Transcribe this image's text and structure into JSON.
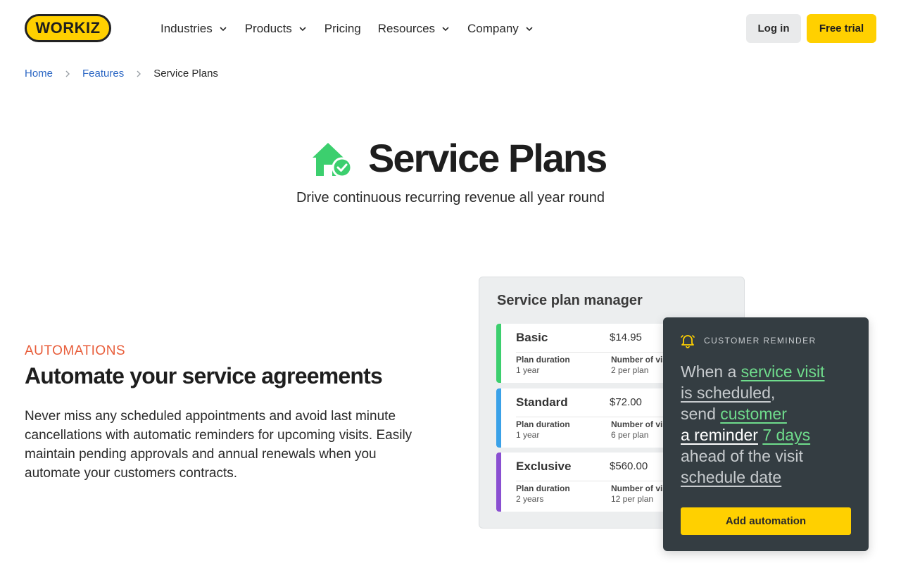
{
  "header": {
    "logo_text": "WORKIZ",
    "nav": [
      {
        "label": "Industries",
        "has_dropdown": true
      },
      {
        "label": "Products",
        "has_dropdown": true
      },
      {
        "label": "Pricing",
        "has_dropdown": false
      },
      {
        "label": "Resources",
        "has_dropdown": true
      },
      {
        "label": "Company",
        "has_dropdown": true
      }
    ],
    "login_label": "Log in",
    "trial_label": "Free trial"
  },
  "breadcrumb": {
    "home": "Home",
    "features": "Features",
    "current": "Service Plans"
  },
  "hero": {
    "icon": "house-check-icon",
    "title": "Service Plans",
    "subtitle": "Drive continuous recurring revenue all year round"
  },
  "section": {
    "eyebrow": "AUTOMATIONS",
    "title": "Automate your service agreements",
    "body": "Never miss any scheduled appointments and avoid last minute cancellations with automatic reminders for upcoming visits. Easily maintain pending approvals and annual renewals when you automate your customers contracts."
  },
  "plan_manager": {
    "title": "Service plan manager",
    "plans": [
      {
        "name": "Basic",
        "price": "$14.95",
        "duration_label": "Plan duration",
        "duration": "1 year",
        "visits_label": "Number of visits",
        "visits": "2 per plan",
        "color": "#3ccf6e"
      },
      {
        "name": "Standard",
        "price": "$72.00",
        "duration_label": "Plan duration",
        "duration": "1 year",
        "visits_label": "Number of visits",
        "visits": "6 per plan",
        "color": "#3aa1e8"
      },
      {
        "name": "Exclusive",
        "price": "$560.00",
        "duration_label": "Plan duration",
        "duration": "2 years",
        "visits_label": "Number of visits",
        "visits": "12 per plan",
        "color": "#8a4fd1"
      }
    ]
  },
  "reminder": {
    "heading": "CUSTOMER REMINDER",
    "t1": "When a",
    "t2": "service visit",
    "t3": "is scheduled",
    "t4": ",",
    "t5": "send",
    "t6": "customer",
    "t7": "a reminder",
    "t8": "7 days",
    "t9": "ahead of the visit",
    "t10": "schedule date",
    "button": "Add automation"
  },
  "colors": {
    "brand_yellow": "#ffd000",
    "link_blue": "#2c67c4",
    "eyebrow_orange": "#e85d3a",
    "accent_green": "#3ccf6e"
  }
}
